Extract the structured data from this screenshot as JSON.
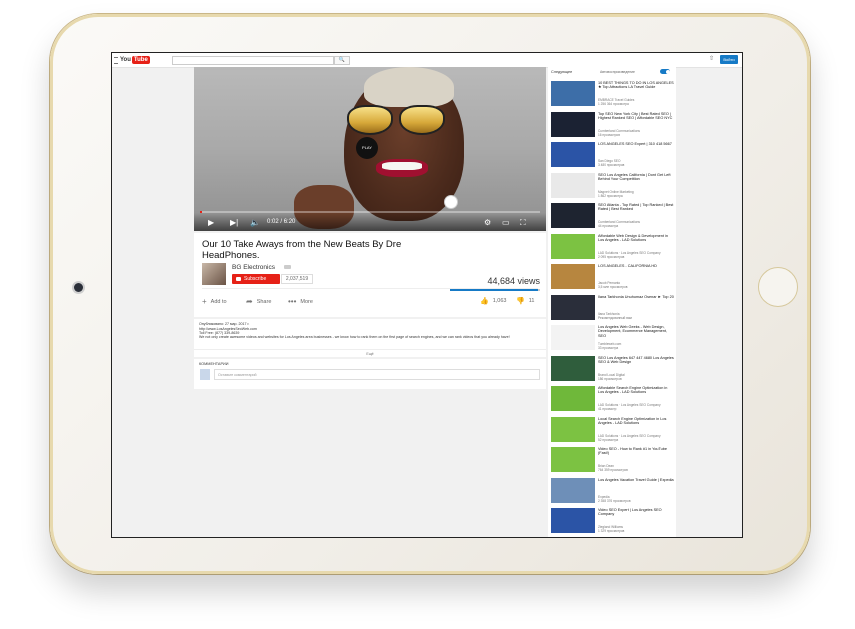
{
  "header": {
    "logo_you": "You",
    "logo_tube": "Tube",
    "search_placeholder": "",
    "search_button": "🔍",
    "signin_label": "Войти"
  },
  "player": {
    "current_time": "0:02",
    "duration": "6:20",
    "progress_fraction": 0.0053,
    "overlay_label": "PLAY",
    "accent": "#e62117"
  },
  "video": {
    "title": "Our 10 Take Aways from the New Beats By Dre HeadPhones.",
    "channel": "BG Electronics",
    "subscribe_label": "Subscribe",
    "subscriber_count": "2,037,519",
    "views": "44,684 views",
    "like_fraction": 0.98,
    "add_label": "Add to",
    "share_label": "Share",
    "more_label": "More",
    "likes": "1,063",
    "dislikes": "11"
  },
  "description": {
    "published": "Опубликовано: 27 мар. 2017 г.",
    "link": "http://www.LosAngelesSeoWeb.com",
    "phone": "Toll Free: (877) 339-8639",
    "text": "We not only create awesome videos and websites for Los Angeles area businesses - we know how to rank them on the first page of search engines, and we can rank videos that you already have!",
    "show_more": "Ещё"
  },
  "comments": {
    "heading": "КОММЕНТАРИИ",
    "placeholder": "Оставьте комментарий"
  },
  "sidebar": {
    "up_next": "Следующее",
    "autoplay_label": "Автовоспроизведение",
    "items": [
      {
        "title": "10 BEST THINGS TO DO IN LOS ANGELES ★ Top Attractions LA Travel Guide",
        "channel": "EMBRACE Travel Guides",
        "views": "1 256 364 просмотра",
        "thumb": "#3d6ea8"
      },
      {
        "title": "Top SEO New York City | Best Rated SEO | Highest Ranked SEO | Affordable SEO NYC",
        "channel": "Cumberland Communications",
        "views": "16 просмотров",
        "thumb": "#1b2233"
      },
      {
        "title": "LOS ANGELES SEO Expert | 310 418 5667",
        "channel": "San Diego SEO",
        "views": "3 480 просмотров",
        "thumb": "#2b54a6"
      },
      {
        "title": "SEO Los Angeles California | Dont Get Left Behind Your Competition",
        "channel": "Magnet Online Marketing",
        "views": "1 862 просмотра",
        "thumb": "#e9e9e9"
      },
      {
        "title": "SEO Atlanta - Top Rated | Top Ranked | Best Rated | Best Ranked",
        "channel": "Cumberland Communications",
        "views": "44 просмотра",
        "thumb": "#1e2430"
      },
      {
        "title": "Affordable Web Design & Development in Los Angeles - LAD Solutions",
        "channel": "LAD Solutions · Los Angeles SEO Company",
        "views": "2 095 просмотров",
        "thumb": "#7cc242"
      },
      {
        "title": "LOS ANGELES - CALIFORNIA HD",
        "channel": "Jacob Pemanto",
        "views": "3,5 млн просмотров",
        "thumb": "#b7863f"
      },
      {
        "title": "Ilana Tarkhonia Unuhumaz Osenar ► Top 20",
        "channel": "Ilana Tarkhonia",
        "views": "Рекомендованный вам",
        "thumb": "#2a2e3a"
      },
      {
        "title": "Los Angeles Web Geeks - Web Design, Development, Ecommerce Management, SEO",
        "channel": "Tumbleweb.com",
        "views": "33 просмотра",
        "thumb": "#f3f3f3"
      },
      {
        "title": "SEO Los Angeles 647 447 4680 Los Angeles SEO & Web Design",
        "channel": "Brand Local Digital",
        "views": "186 просмотров",
        "thumb": "#2f5d3c"
      },
      {
        "title": "Affordable Search Engine Optimization in Los Angeles - LAD Solutions",
        "channel": "LAD Solutions · Los Angeles SEO Company",
        "views": "41 просмотр",
        "thumb": "#6fb83a"
      },
      {
        "title": "Local Search Engine Optimization in Los Angeles - LAD Solutions",
        "channel": "LAD Solutions · Los Angeles SEO Company",
        "views": "52 просмотра",
        "thumb": "#7cc242"
      },
      {
        "title": "Video SEO - How to Rank #1 in YouTube (Fast!)",
        "channel": "Brian Dean",
        "views": "764 359 просмотров",
        "thumb": "#7cc242"
      },
      {
        "title": "Los Angeles Vacation Travel Guide | Expedia",
        "channel": "Expedia",
        "views": "2 358 376 просмотров",
        "thumb": "#6e8fb8"
      },
      {
        "title": "Video SEO Expert | Los Angeles SEO Company",
        "channel": "Ziegland Williams",
        "views": "1 329 просмотров",
        "thumb": "#2b54a6"
      }
    ]
  }
}
